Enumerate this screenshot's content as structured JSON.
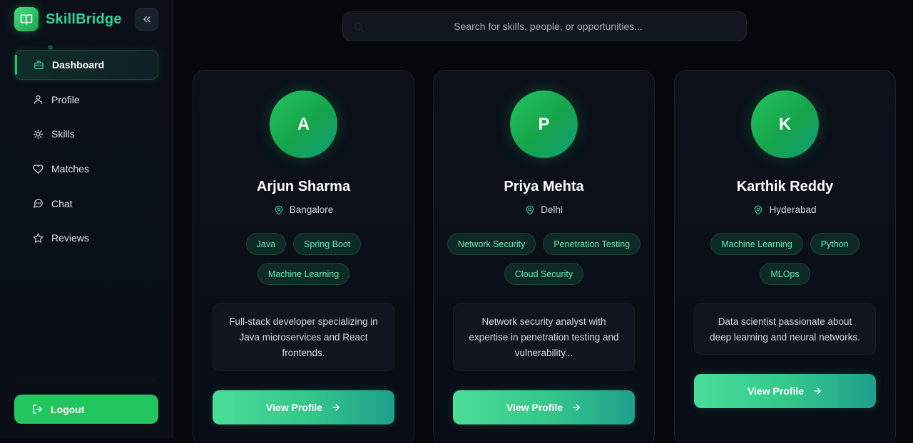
{
  "brand": {
    "name": "SkillBridge",
    "logo_icon": "book-open-icon"
  },
  "sidebar": {
    "collapse_icon": "chevrons-left-icon",
    "items": [
      {
        "label": "Dashboard",
        "icon": "briefcase-icon",
        "active": true
      },
      {
        "label": "Profile",
        "icon": "user-icon"
      },
      {
        "label": "Skills",
        "icon": "lightbulb-icon"
      },
      {
        "label": "Matches",
        "icon": "heart-icon"
      },
      {
        "label": "Chat",
        "icon": "message-circle-icon"
      },
      {
        "label": "Reviews",
        "icon": "star-icon"
      }
    ],
    "logout_label": "Logout"
  },
  "search": {
    "placeholder": "Search for skills, people, or opportunities..."
  },
  "cards": [
    {
      "initial": "A",
      "name": "Arjun Sharma",
      "location": "Bangalore",
      "tags": [
        "Java",
        "Spring Boot",
        "Machine Learning"
      ],
      "bio": "Full-stack developer specializing in Java microservices and React frontends.",
      "button": "View Profile"
    },
    {
      "initial": "P",
      "name": "Priya Mehta",
      "location": "Delhi",
      "tags": [
        "Network Security",
        "Penetration Testing",
        "Cloud Security"
      ],
      "bio": "Network security analyst with expertise in penetration testing and vulnerability...",
      "button": "View Profile"
    },
    {
      "initial": "K",
      "name": "Karthik Reddy",
      "location": "Hyderabad",
      "tags": [
        "Machine Learning",
        "Python",
        "MLOps"
      ],
      "bio": "Data scientist passionate about deep learning and neural networks.",
      "button": "View Profile"
    }
  ],
  "colors": {
    "accent": "#22c55e",
    "tag_text": "#6ee7b7",
    "background": "#05070c"
  }
}
